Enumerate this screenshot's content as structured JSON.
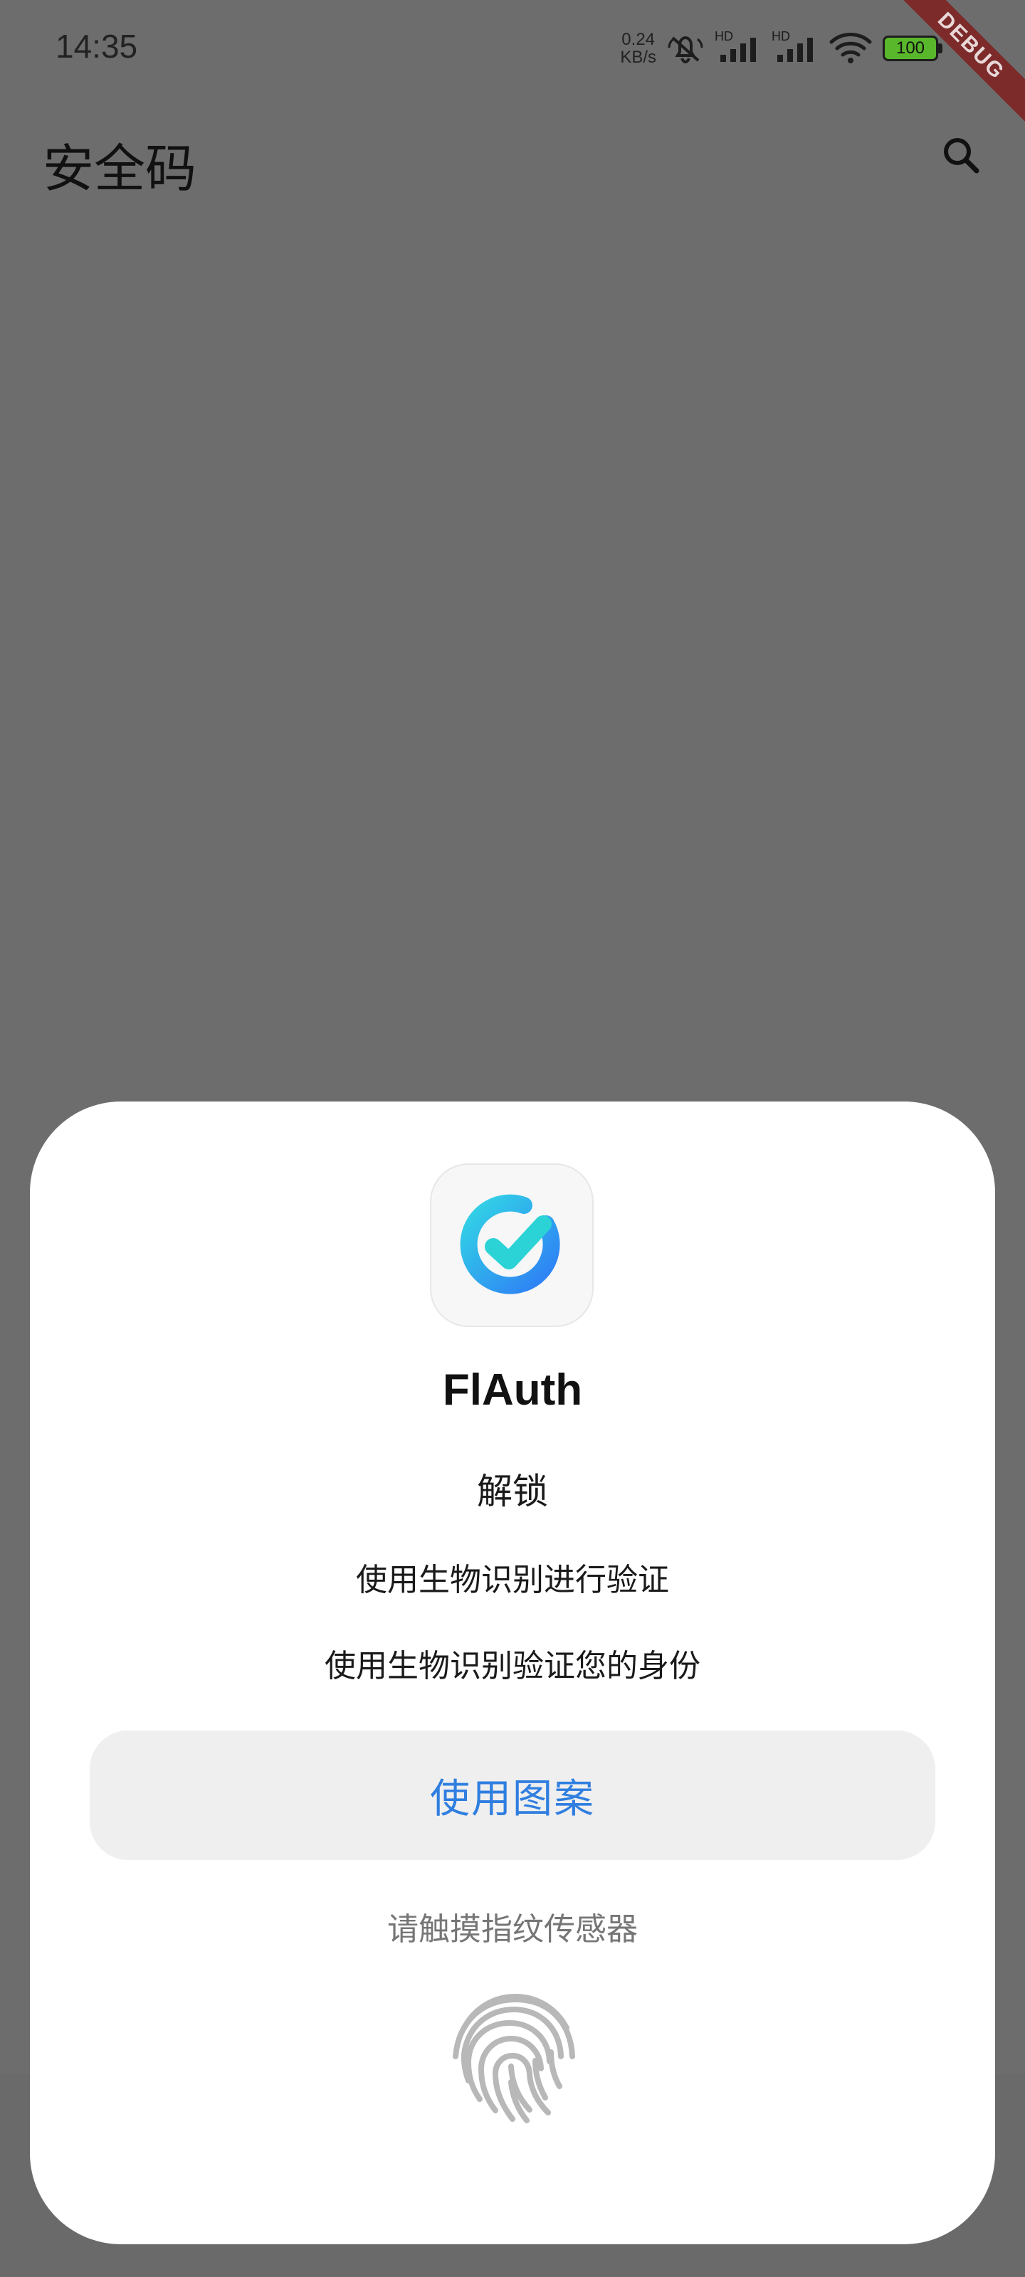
{
  "status_bar": {
    "time": "14:35",
    "speed_value": "0.24",
    "speed_unit": "KB/s",
    "signal_1_label": "HD",
    "signal_2_label": "HD",
    "battery_level": "100",
    "debug_label": "DEBUG"
  },
  "app_bar": {
    "title": "安全码",
    "search_icon": "search-icon"
  },
  "dialog": {
    "app_name": "FlAuth",
    "title": "解锁",
    "subtitle": "使用生物识别进行验证",
    "description": "使用生物识别验证您的身份",
    "pattern_button": "使用图案",
    "sensor_hint": "请触摸指纹传感器",
    "fingerprint_icon": "fingerprint-icon",
    "app_icon": "check-circle-logo-icon"
  },
  "colors": {
    "scrim": "#6d6d6d",
    "dialog_bg": "#ffffff",
    "button_bg": "#efefef",
    "button_text": "#2f7ee0",
    "hint_text": "#767676",
    "logo_gradient_start": "#32d6e5",
    "logo_gradient_end": "#2e7cf6"
  }
}
